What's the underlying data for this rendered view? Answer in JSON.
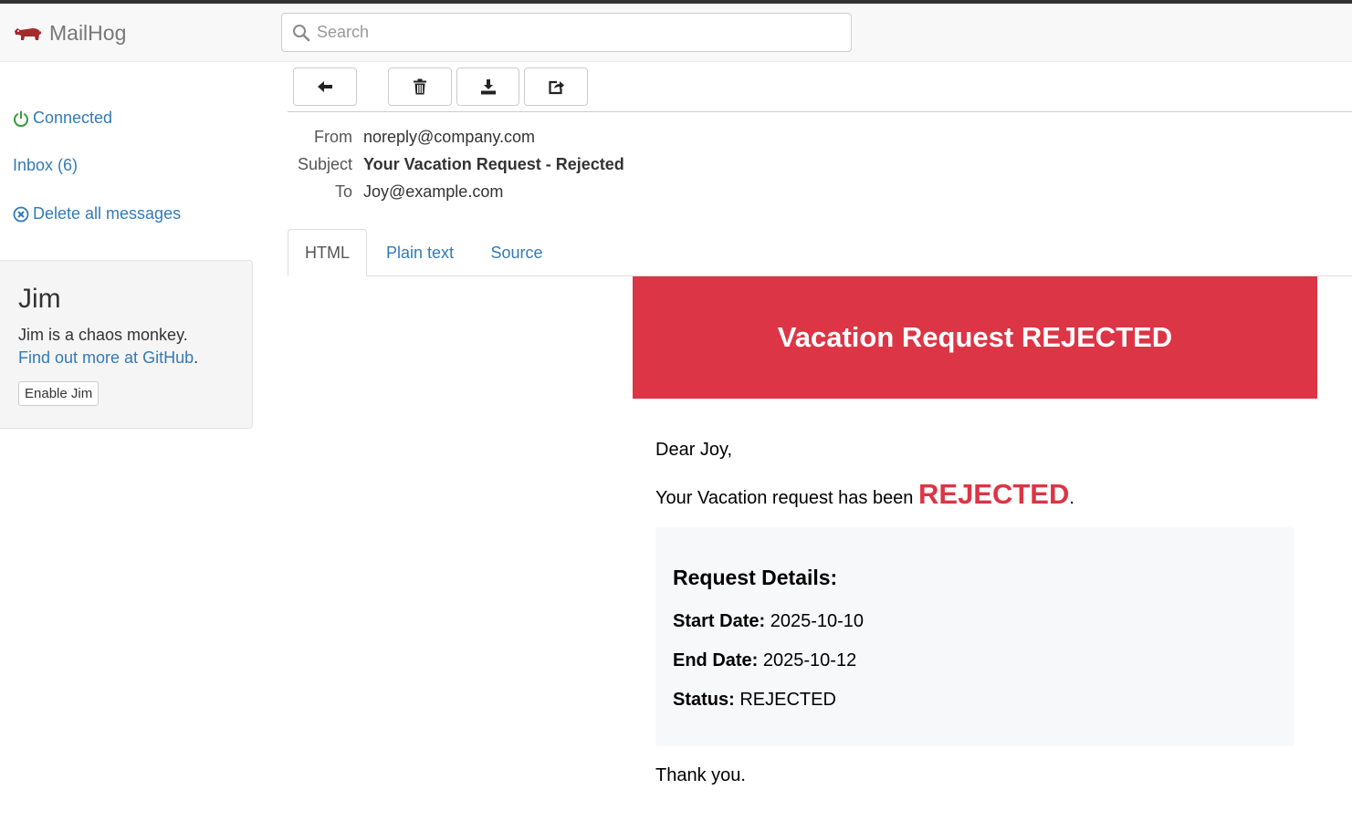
{
  "app": {
    "name": "MailHog"
  },
  "search": {
    "placeholder": "Search"
  },
  "sidebar": {
    "connected": "Connected",
    "inbox": "Inbox (6)",
    "delete_all": "Delete all messages"
  },
  "jim": {
    "title": "Jim",
    "description": "Jim is a chaos monkey.",
    "link_text": "Find out more at GitHub",
    "link_suffix": ".",
    "button": "Enable Jim"
  },
  "toolbar": {
    "buttons": [
      {
        "icon": "arrow-left-icon"
      },
      {
        "icon": "trash-icon"
      },
      {
        "icon": "download-icon"
      },
      {
        "icon": "share-icon"
      }
    ]
  },
  "message": {
    "from_label": "From",
    "from": "noreply@company.com",
    "subject_label": "Subject",
    "subject": "Your Vacation Request - Rejected",
    "to_label": "To",
    "to": "Joy@example.com"
  },
  "tabs": [
    {
      "label": "HTML",
      "active": true
    },
    {
      "label": "Plain text",
      "active": false
    },
    {
      "label": "Source",
      "active": false
    }
  ],
  "email": {
    "banner": "Vacation Request REJECTED",
    "greeting": "Dear Joy,",
    "status_prefix": "Your Vacation request has been ",
    "status_word": "REJECTED",
    "status_suffix": ".",
    "details_title": "Request Details:",
    "start_label": "Start Date:",
    "start_value": " 2025-10-10",
    "end_label": "End Date:",
    "end_value": " 2025-10-12",
    "status_label": "Status:",
    "status_value": " REJECTED",
    "closing": "Thank you."
  },
  "colors": {
    "brand_icon": "#a52a2a",
    "link": "#337ab7",
    "connected": "#3c9b3c",
    "banner": "#dc3545"
  }
}
